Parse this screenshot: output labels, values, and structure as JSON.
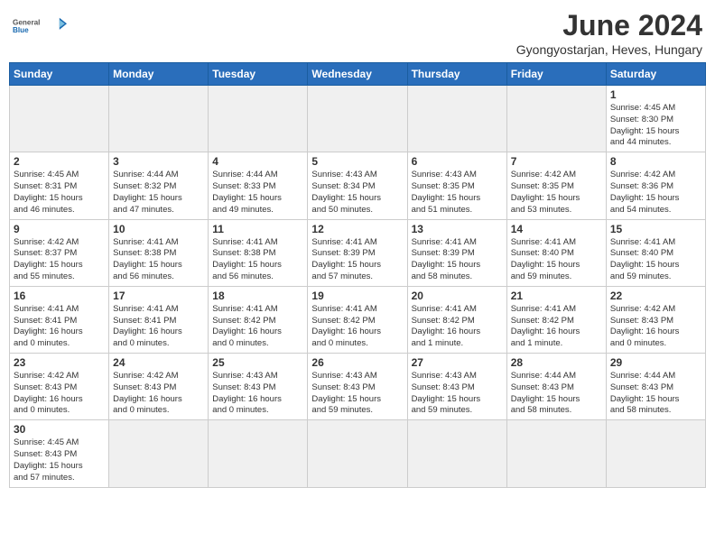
{
  "header": {
    "logo_text_regular": "General",
    "logo_text_blue": "Blue",
    "title": "June 2024",
    "location": "Gyongyostarjan, Heves, Hungary"
  },
  "weekdays": [
    "Sunday",
    "Monday",
    "Tuesday",
    "Wednesday",
    "Thursday",
    "Friday",
    "Saturday"
  ],
  "days": [
    {
      "date": "",
      "info": ""
    },
    {
      "date": "",
      "info": ""
    },
    {
      "date": "",
      "info": ""
    },
    {
      "date": "",
      "info": ""
    },
    {
      "date": "",
      "info": ""
    },
    {
      "date": "",
      "info": ""
    },
    {
      "date": "1",
      "info": "Sunrise: 4:45 AM\nSunset: 8:30 PM\nDaylight: 15 hours\nand 44 minutes."
    },
    {
      "date": "2",
      "info": "Sunrise: 4:45 AM\nSunset: 8:31 PM\nDaylight: 15 hours\nand 46 minutes."
    },
    {
      "date": "3",
      "info": "Sunrise: 4:44 AM\nSunset: 8:32 PM\nDaylight: 15 hours\nand 47 minutes."
    },
    {
      "date": "4",
      "info": "Sunrise: 4:44 AM\nSunset: 8:33 PM\nDaylight: 15 hours\nand 49 minutes."
    },
    {
      "date": "5",
      "info": "Sunrise: 4:43 AM\nSunset: 8:34 PM\nDaylight: 15 hours\nand 50 minutes."
    },
    {
      "date": "6",
      "info": "Sunrise: 4:43 AM\nSunset: 8:35 PM\nDaylight: 15 hours\nand 51 minutes."
    },
    {
      "date": "7",
      "info": "Sunrise: 4:42 AM\nSunset: 8:35 PM\nDaylight: 15 hours\nand 53 minutes."
    },
    {
      "date": "8",
      "info": "Sunrise: 4:42 AM\nSunset: 8:36 PM\nDaylight: 15 hours\nand 54 minutes."
    },
    {
      "date": "9",
      "info": "Sunrise: 4:42 AM\nSunset: 8:37 PM\nDaylight: 15 hours\nand 55 minutes."
    },
    {
      "date": "10",
      "info": "Sunrise: 4:41 AM\nSunset: 8:38 PM\nDaylight: 15 hours\nand 56 minutes."
    },
    {
      "date": "11",
      "info": "Sunrise: 4:41 AM\nSunset: 8:38 PM\nDaylight: 15 hours\nand 56 minutes."
    },
    {
      "date": "12",
      "info": "Sunrise: 4:41 AM\nSunset: 8:39 PM\nDaylight: 15 hours\nand 57 minutes."
    },
    {
      "date": "13",
      "info": "Sunrise: 4:41 AM\nSunset: 8:39 PM\nDaylight: 15 hours\nand 58 minutes."
    },
    {
      "date": "14",
      "info": "Sunrise: 4:41 AM\nSunset: 8:40 PM\nDaylight: 15 hours\nand 59 minutes."
    },
    {
      "date": "15",
      "info": "Sunrise: 4:41 AM\nSunset: 8:40 PM\nDaylight: 15 hours\nand 59 minutes."
    },
    {
      "date": "16",
      "info": "Sunrise: 4:41 AM\nSunset: 8:41 PM\nDaylight: 16 hours\nand 0 minutes."
    },
    {
      "date": "17",
      "info": "Sunrise: 4:41 AM\nSunset: 8:41 PM\nDaylight: 16 hours\nand 0 minutes."
    },
    {
      "date": "18",
      "info": "Sunrise: 4:41 AM\nSunset: 8:42 PM\nDaylight: 16 hours\nand 0 minutes."
    },
    {
      "date": "19",
      "info": "Sunrise: 4:41 AM\nSunset: 8:42 PM\nDaylight: 16 hours\nand 0 minutes."
    },
    {
      "date": "20",
      "info": "Sunrise: 4:41 AM\nSunset: 8:42 PM\nDaylight: 16 hours\nand 1 minute."
    },
    {
      "date": "21",
      "info": "Sunrise: 4:41 AM\nSunset: 8:42 PM\nDaylight: 16 hours\nand 1 minute."
    },
    {
      "date": "22",
      "info": "Sunrise: 4:42 AM\nSunset: 8:43 PM\nDaylight: 16 hours\nand 0 minutes."
    },
    {
      "date": "23",
      "info": "Sunrise: 4:42 AM\nSunset: 8:43 PM\nDaylight: 16 hours\nand 0 minutes."
    },
    {
      "date": "24",
      "info": "Sunrise: 4:42 AM\nSunset: 8:43 PM\nDaylight: 16 hours\nand 0 minutes."
    },
    {
      "date": "25",
      "info": "Sunrise: 4:43 AM\nSunset: 8:43 PM\nDaylight: 16 hours\nand 0 minutes."
    },
    {
      "date": "26",
      "info": "Sunrise: 4:43 AM\nSunset: 8:43 PM\nDaylight: 15 hours\nand 59 minutes."
    },
    {
      "date": "27",
      "info": "Sunrise: 4:43 AM\nSunset: 8:43 PM\nDaylight: 15 hours\nand 59 minutes."
    },
    {
      "date": "28",
      "info": "Sunrise: 4:44 AM\nSunset: 8:43 PM\nDaylight: 15 hours\nand 58 minutes."
    },
    {
      "date": "29",
      "info": "Sunrise: 4:44 AM\nSunset: 8:43 PM\nDaylight: 15 hours\nand 58 minutes."
    },
    {
      "date": "30",
      "info": "Sunrise: 4:45 AM\nSunset: 8:43 PM\nDaylight: 15 hours\nand 57 minutes."
    },
    {
      "date": "",
      "info": ""
    },
    {
      "date": "",
      "info": ""
    },
    {
      "date": "",
      "info": ""
    },
    {
      "date": "",
      "info": ""
    },
    {
      "date": "",
      "info": ""
    },
    {
      "date": "",
      "info": ""
    }
  ]
}
